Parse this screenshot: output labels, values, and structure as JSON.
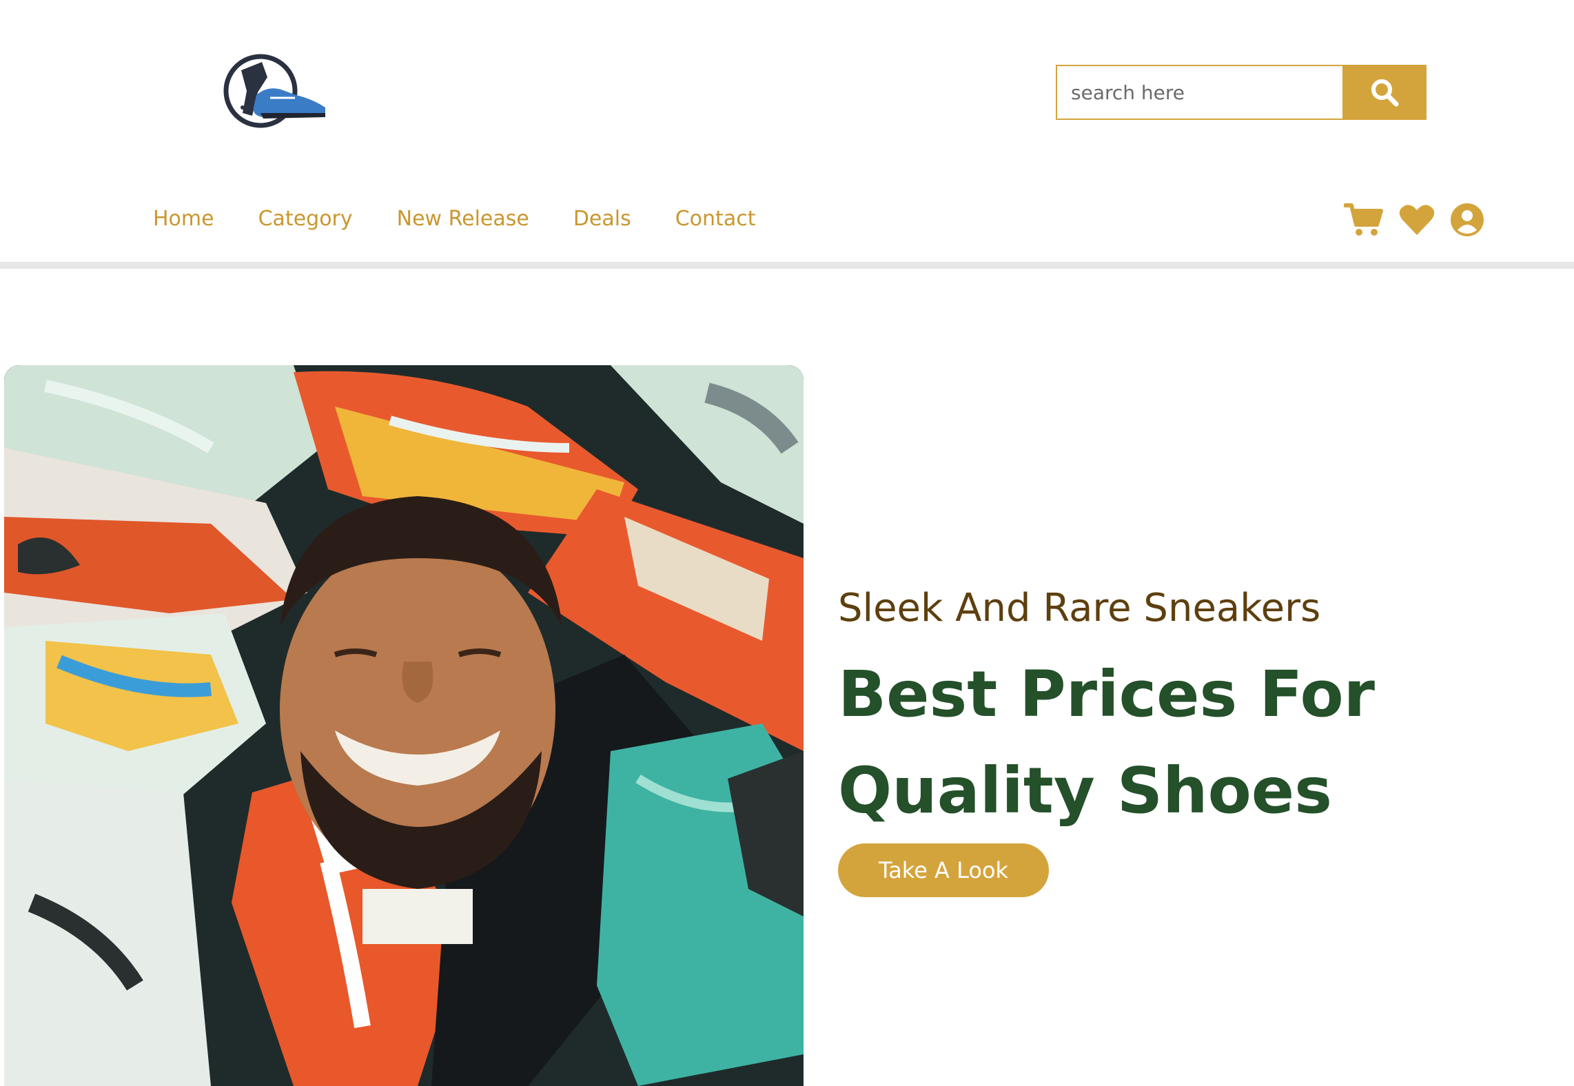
{
  "header": {
    "logo_icon": "sneaker-logo-icon",
    "search": {
      "placeholder": "search here",
      "button_icon": "search-icon"
    }
  },
  "nav": {
    "items": [
      "Home",
      "Category",
      "New Release",
      "Deals",
      "Contact"
    ],
    "icons": [
      "cart-icon",
      "heart-icon",
      "user-icon"
    ]
  },
  "hero": {
    "subtitle": "Sleek And Rare Sneakers",
    "title": "Best Prices For Quality Shoes",
    "cta_label": "Take A Look",
    "image": "smiling-man-among-sneakers-photo"
  },
  "colors": {
    "accent": "#d4a43c",
    "nav_text": "#c9972f",
    "subtitle": "#5e3f0e",
    "title": "#24502a",
    "divider": "#e6e6e6"
  }
}
